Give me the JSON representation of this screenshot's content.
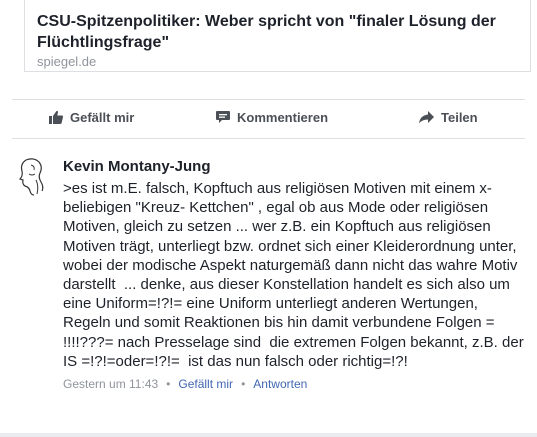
{
  "link_preview": {
    "title": "CSU-Spitzenpolitiker: Weber spricht von \"finaler Lösung der Flüchtlingsfrage\"",
    "domain": "spiegel.de"
  },
  "actions": {
    "like_label": "Gefällt mir",
    "comment_label": "Kommentieren",
    "share_label": "Teilen"
  },
  "comment": {
    "author": "Kevin Montany-Jung",
    "text": ">es ist m.E. falsch, Kopftuch aus religiösen Motiven mit einem x-beliebigen \"Kreuz- Kettchen\" , egal ob aus Mode oder religiösen Motiven, gleich zu setzen ... wer z.B. ein Kopftuch aus religiösen Motiven trägt, unterliegt bzw. ordnet sich einer Kleiderordnung unter, wobei der modische Aspekt naturgemäß dann nicht das wahre Motiv darstellt  ... denke, aus dieser Konstellation handelt es sich also um eine Uniform=!?!= eine Uniform unterliegt anderen Wertungen, Regeln und somit Reaktionen bis hin damit verbundene Folgen = !!!!???= nach Presselage sind  die extremen Folgen bekannt, z.B. der IS =!?!=oder=!?!=  ist das nun falsch oder richtig=!?!",
    "timestamp": "Gestern um 11:43",
    "like_label": "Gefällt mir",
    "reply_label": "Antworten"
  }
}
